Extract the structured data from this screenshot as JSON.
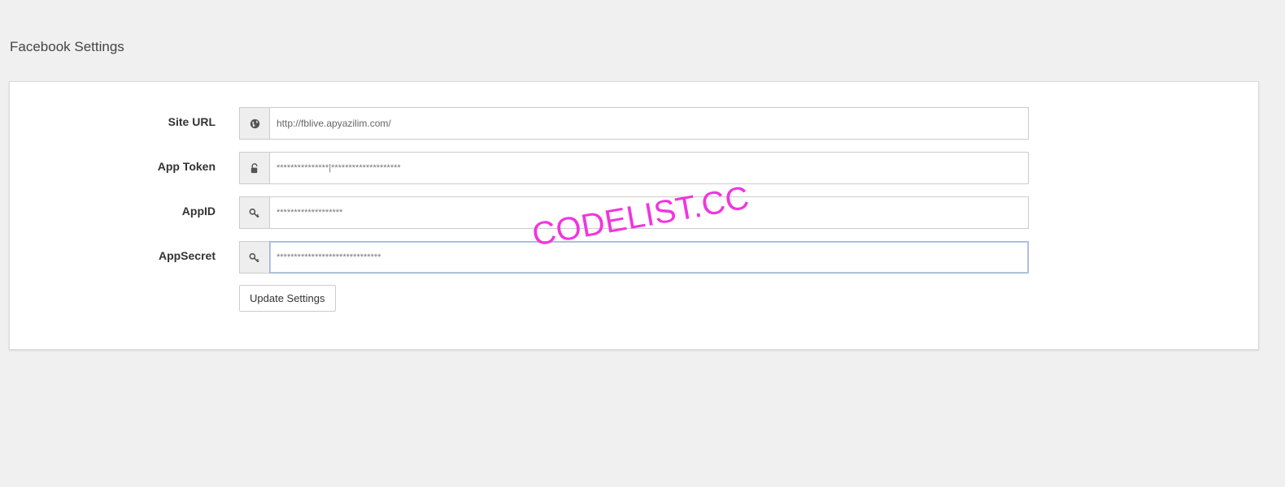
{
  "page": {
    "title": "Facebook Settings"
  },
  "form": {
    "fields": [
      {
        "label": "Site URL",
        "icon": "globe-icon",
        "value": "http://fblive.apyazilim.com/"
      },
      {
        "label": "App Token",
        "icon": "unlock-icon",
        "value": "***************|********************"
      },
      {
        "label": "AppID",
        "icon": "key-icon",
        "value": "*******************"
      },
      {
        "label": "AppSecret",
        "icon": "key-icon",
        "value": "******************************"
      }
    ],
    "submit_label": "Update Settings"
  },
  "watermark": {
    "text": "CODELIST.CC",
    "color": "#f035e0"
  },
  "colors": {
    "background": "#f0f0f0",
    "panel": "#ffffff",
    "focus_border": "#a3b7d9"
  }
}
